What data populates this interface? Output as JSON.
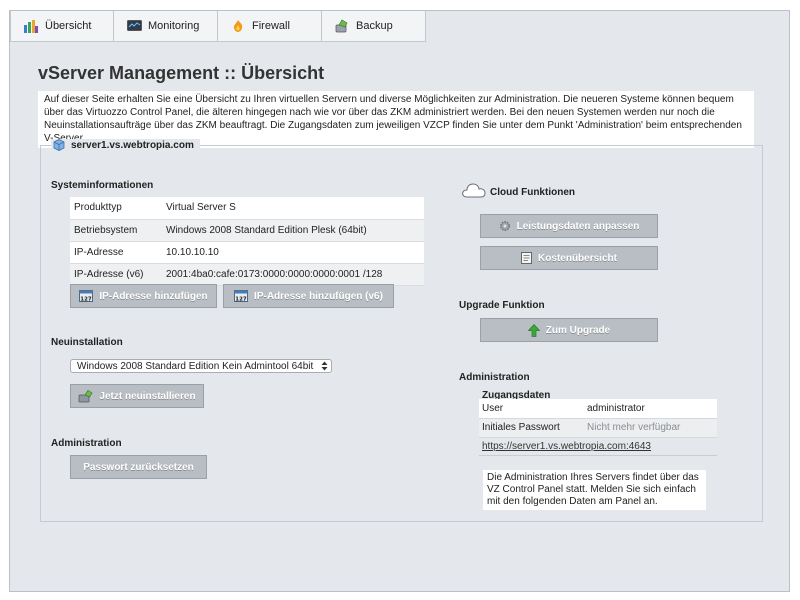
{
  "tabs": [
    {
      "label": "Übersicht",
      "icon": "overview-icon"
    },
    {
      "label": "Monitoring",
      "icon": "monitor-icon"
    },
    {
      "label": "Firewall",
      "icon": "firewall-icon"
    },
    {
      "label": "Backup",
      "icon": "backup-icon"
    }
  ],
  "page": {
    "title": "vServer Management :: Übersicht",
    "intro": "Auf dieser Seite erhalten Sie eine Übersicht zu Ihren virtuellen Servern und diverse Möglichkeiten zur Administration. Die neueren Systeme können bequem über das Virtuozzo Control Panel, die älteren hingegen nach wie vor über das ZKM administriert werden. Bei den neuen Systemen werden nur noch die Neuinstallationsaufträge über das ZKM beauftragt. Die Zugangsdaten zum jeweiligen VZCP finden Sie unter dem Punkt 'Administration' beim entsprechenden V-Server."
  },
  "server": {
    "hostname": "server1.vs.webtropia.com",
    "sysinfo_heading": "Systeminformationen",
    "sysinfo": [
      {
        "key": "Produkttyp",
        "value": "Virtual Server S"
      },
      {
        "key": "Betriebsystem",
        "value": "Windows 2008 Standard Edition Plesk (64bit)"
      },
      {
        "key": "IP-Adresse",
        "value": "10.10.10.10"
      },
      {
        "key": "IP-Adresse (v6)",
        "value": "2001:4ba0:cafe:0173:0000:0000:0000:0001 /128"
      }
    ],
    "add_ip_button": "IP-Adresse hinzufügen",
    "add_ipv6_button": "IP-Adresse hinzufügen (v6)",
    "reinstall_heading": "Neuinstallation",
    "os_select_value": "Windows 2008 Standard Edition Kein Admintool 64bit",
    "reinstall_button": "Jetzt neuinstallieren",
    "admin_heading_left": "Administration",
    "reset_password_button": "Passwort zurücksetzen",
    "cloud_heading": "Cloud Funktionen",
    "adjust_performance_button": "Leistungsdaten anpassen",
    "cost_overview_button": "Kostenübersicht",
    "upgrade_heading": "Upgrade Funktion",
    "upgrade_button": "Zum Upgrade",
    "admin_heading_right": "Administration",
    "credentials_heading": "Zugangsdaten",
    "credentials": [
      {
        "key": "User",
        "value": "administrator"
      },
      {
        "key": "Initiales Passwort",
        "value": "Nicht mehr verfügbar"
      }
    ],
    "panel_link": "https://server1.vs.webtropia.com:4643",
    "admin_note": "Die Administration Ihres Servers findet über das VZ Control Panel statt. Melden Sie sich einfach mit den folgenden Daten am Panel an."
  },
  "colors": {
    "background": "#e4e8ec",
    "button": "#b9bec4",
    "upgrade_arrow": "#3aa83a"
  }
}
